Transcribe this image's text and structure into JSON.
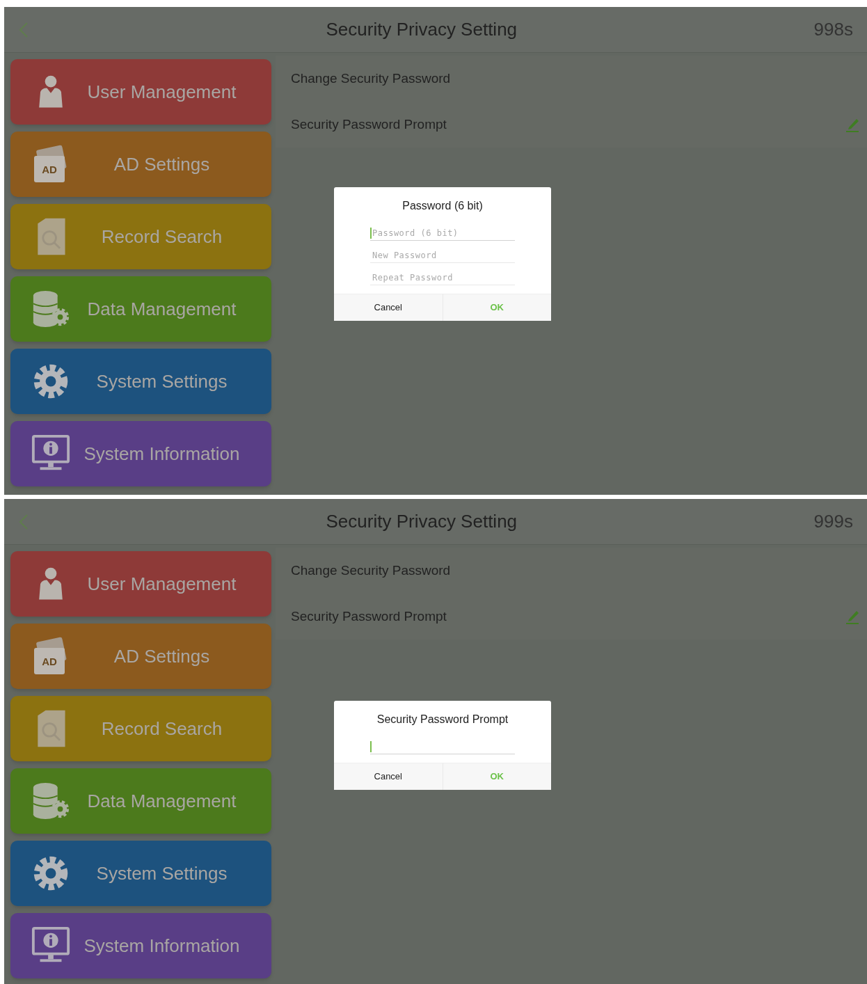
{
  "screens": [
    {
      "title": "Security Privacy Setting",
      "timer": "998s",
      "menu": [
        {
          "label": "User Management",
          "kind": "user",
          "color": "#8e3a38"
        },
        {
          "label": "AD Settings",
          "kind": "ad",
          "icon_text": "AD",
          "color": "#8c5a1e"
        },
        {
          "label": "Record Search",
          "kind": "search",
          "color": "#8c7210"
        },
        {
          "label": "Data Management",
          "kind": "database",
          "color": "#4c7a1c"
        },
        {
          "label": "System Settings",
          "kind": "gear",
          "color": "#1d527e"
        },
        {
          "label": "System Information",
          "kind": "info",
          "color": "#593e86"
        }
      ],
      "settings": [
        {
          "label": "Change Security Password",
          "kind": "plain"
        },
        {
          "label": "Security Password Prompt",
          "kind": "edit"
        }
      ],
      "dialog": {
        "title": "Password (6 bit)",
        "fields": [
          {
            "placeholder": "Password (6 bit)",
            "focused": true
          },
          {
            "placeholder": "New Password",
            "focused": false
          },
          {
            "placeholder": "Repeat Password",
            "focused": false
          }
        ],
        "buttons": [
          {
            "label": "Cancel",
            "kind": "cancel"
          },
          {
            "label": "OK",
            "kind": "ok"
          }
        ]
      }
    },
    {
      "title": "Security Privacy Setting",
      "timer": "999s",
      "menu": [
        {
          "label": "User Management",
          "kind": "user",
          "color": "#8e3a38"
        },
        {
          "label": "AD Settings",
          "kind": "ad",
          "icon_text": "AD",
          "color": "#8c5a1e"
        },
        {
          "label": "Record Search",
          "kind": "search",
          "color": "#8c7210"
        },
        {
          "label": "Data Management",
          "kind": "database",
          "color": "#4c7a1c"
        },
        {
          "label": "System Settings",
          "kind": "gear",
          "color": "#1d527e"
        },
        {
          "label": "System Information",
          "kind": "info",
          "color": "#593e86"
        }
      ],
      "settings": [
        {
          "label": "Change Security Password",
          "kind": "plain"
        },
        {
          "label": "Security Password Prompt",
          "kind": "edit"
        }
      ],
      "dialog": {
        "title": "Security Password Prompt",
        "fields": [
          {
            "focused": true
          }
        ],
        "buttons": [
          {
            "label": "Cancel",
            "kind": "cancel"
          },
          {
            "label": "OK",
            "kind": "ok"
          }
        ]
      }
    }
  ]
}
